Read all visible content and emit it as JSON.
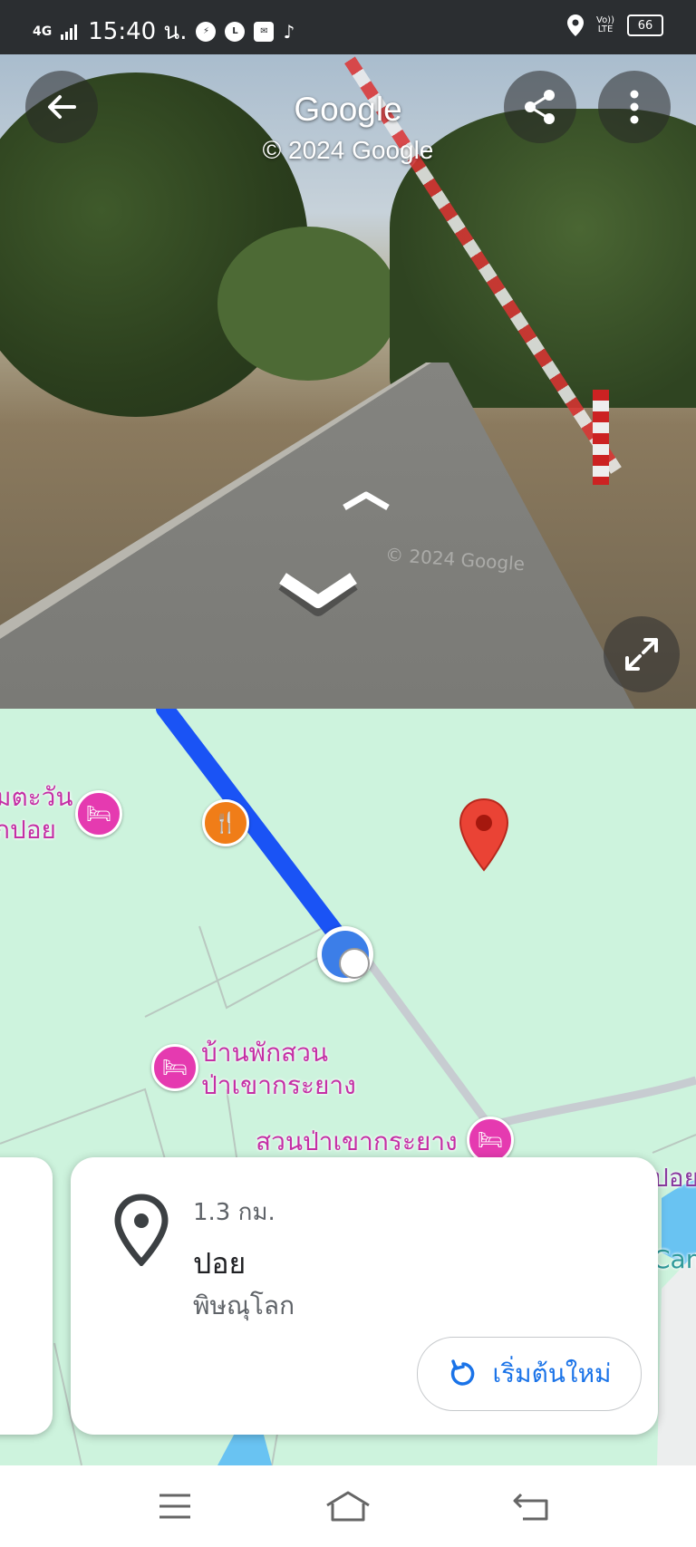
{
  "status_bar": {
    "network": "4G",
    "time": "15:40 น.",
    "apps": [
      "messenger-icon",
      "line-icon",
      "email-icon",
      "tiktok-icon"
    ],
    "right_icons": [
      "location-icon",
      "volte-icon"
    ],
    "volte_label": "Vo))\nLTE",
    "battery": "66"
  },
  "street_view": {
    "header_title": "Google",
    "copyright": "© 2024 Google",
    "watermark": "© 2024 Google",
    "buttons": [
      "back-arrow-icon",
      "share-icon",
      "more-vert-icon",
      "fullscreen-icon"
    ]
  },
  "map": {
    "labels": {
      "hotel_top_left": "มตะวัน\nกปอย",
      "hotel_garden": "บ้านพักสวน\nป่าเขากระยาง",
      "park": "สวนป่าเขากระยาง",
      "right_edge_1": "ปอย",
      "right_edge_2": "Cam"
    },
    "colors": {
      "background": "#cdf3dd",
      "route": "#1a53f5",
      "pin": "#ea4335",
      "poi_hotel": "#e53ab0",
      "poi_food": "#f07d18"
    }
  },
  "card": {
    "distance": "1.3 กม.",
    "title": "ปอย",
    "subtitle": "พิษณุโลก",
    "restart_label": "เริ่มต้นใหม่"
  },
  "nav_bar": {
    "buttons": [
      "menu-icon",
      "home-icon",
      "back-icon"
    ]
  }
}
